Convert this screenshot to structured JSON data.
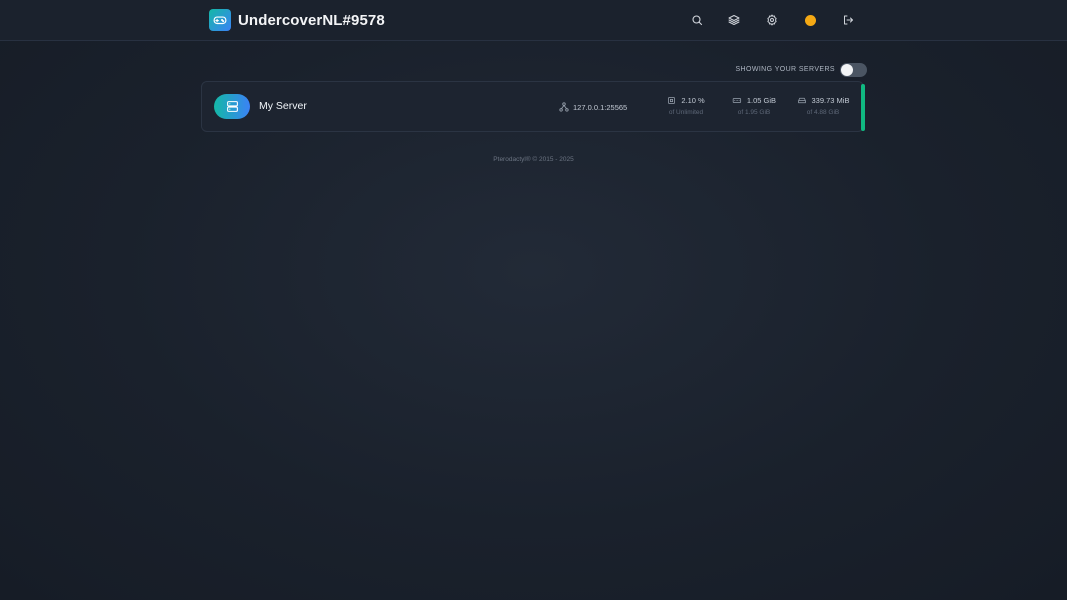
{
  "header": {
    "app_name": "UndercoverNL#9578",
    "icons": [
      "search-icon",
      "layers-icon",
      "gear-icon",
      "avatar",
      "logout-icon"
    ],
    "avatar_color": "#f5a914"
  },
  "server_list": {
    "toggle_label": "SHOWING YOUR SERVERS",
    "toggle_on": false,
    "servers": [
      {
        "name": "My Server",
        "address": "127.0.0.1:25565",
        "cpu": {
          "value": "2.10 %",
          "limit": "of Unlimited"
        },
        "memory": {
          "value": "1.05 GiB",
          "limit": "of 1.95 GiB"
        },
        "disk": {
          "value": "339.73 MiB",
          "limit": "of 4.88 GiB"
        },
        "status_color": "#10b981"
      }
    ]
  },
  "footer": {
    "text": "Pterodactyl® © 2015 - 2025"
  }
}
